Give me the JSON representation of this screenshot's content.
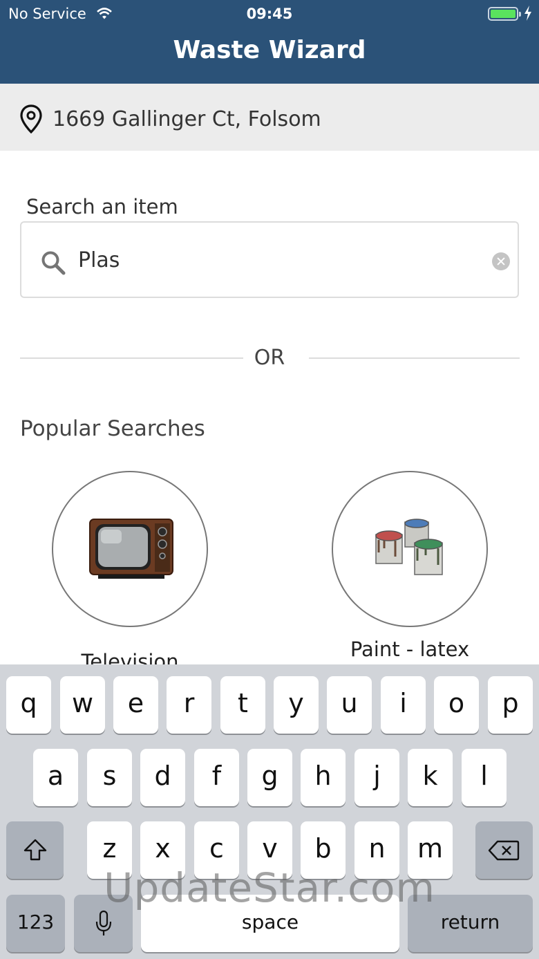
{
  "status_bar": {
    "carrier": "No Service",
    "time": "09:45"
  },
  "header": {
    "title": "Waste Wizard"
  },
  "location": {
    "address": "1669 Gallinger Ct, Folsom"
  },
  "search": {
    "label": "Search an item",
    "value": "Plas"
  },
  "divider": {
    "text": "OR"
  },
  "popular": {
    "title": "Popular Searches",
    "items": [
      {
        "label": "Television",
        "icon": "television-icon"
      },
      {
        "label": "Paint - latex",
        "icon": "paint-cans-icon"
      }
    ]
  },
  "keyboard": {
    "row1": [
      "q",
      "w",
      "e",
      "r",
      "t",
      "y",
      "u",
      "i",
      "o",
      "p"
    ],
    "row2": [
      "a",
      "s",
      "d",
      "f",
      "g",
      "h",
      "j",
      "k",
      "l"
    ],
    "row3": [
      "z",
      "x",
      "c",
      "v",
      "b",
      "n",
      "m"
    ],
    "numbers_label": "123",
    "space_label": "space",
    "return_label": "return"
  },
  "watermark": "UpdateStar.com",
  "colors": {
    "header_bg": "#2b5278",
    "address_bg": "#ececec",
    "keyboard_bg": "#d1d4d9"
  }
}
